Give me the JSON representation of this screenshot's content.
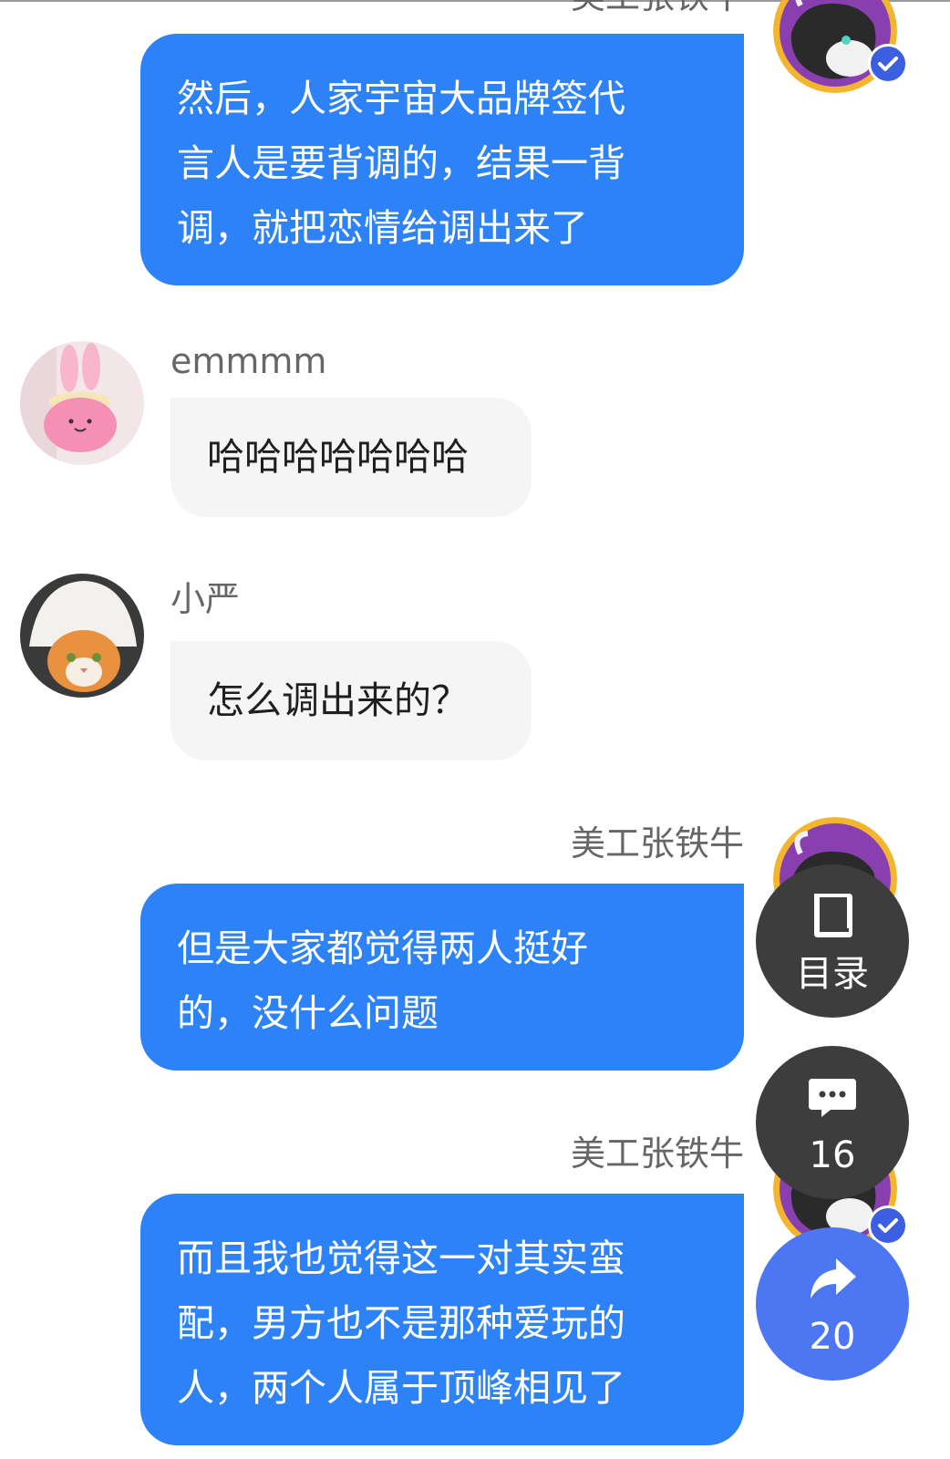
{
  "messages": [
    {
      "sender": "美工张铁牛",
      "side": "right",
      "lines": [
        "然后，人家宇宙大品牌签代",
        "言人是要背调的，结果一背",
        "调，就把恋情给调出来了"
      ]
    },
    {
      "sender": "emmmm",
      "side": "left",
      "lines": [
        "哈哈哈哈哈哈哈"
      ]
    },
    {
      "sender": "小严",
      "side": "left",
      "lines": [
        "怎么调出来的？"
      ]
    },
    {
      "sender": "美工张铁牛",
      "side": "right",
      "lines": [
        "但是大家都觉得两人挺好",
        "的，没什么问题"
      ]
    },
    {
      "sender": "美工张铁牛",
      "side": "right",
      "lines": [
        "而且我也觉得这一对其实蛮",
        "配，男方也不是那种爱玩的",
        "人，两个人属于顶峰相见了"
      ]
    }
  ],
  "floating_buttons": {
    "toc": {
      "label": "目录",
      "icon": "book-icon"
    },
    "comments": {
      "label": "16",
      "icon": "chat-bubble-icon"
    },
    "share": {
      "label": "20",
      "icon": "share-arrow-icon"
    }
  },
  "colors": {
    "outgoing_bubble": "#2d82f7",
    "incoming_bubble": "#f5f5f5",
    "fab_dark": "#3d3d3d",
    "fab_blue": "#4d76f2",
    "verified_badge": "#3c5ee0"
  }
}
